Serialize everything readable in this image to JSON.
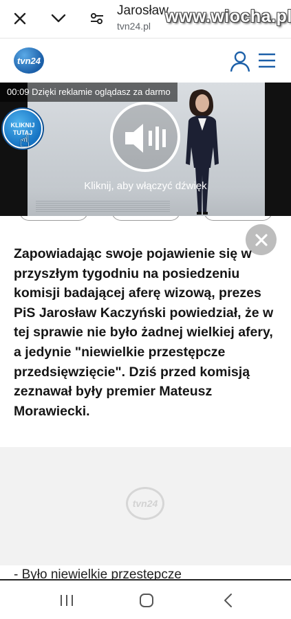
{
  "browser": {
    "title": "Jarosław",
    "url": "tvn24.pl",
    "close_icon": "close-icon",
    "dropdown_icon": "chevron-down-icon",
    "settings_icon": "page-settings-icon"
  },
  "watermark": "www.wiocha.pl",
  "site": {
    "logo_text": "tvn24",
    "user_icon": "user-icon",
    "menu_icon": "hamburger-menu-icon"
  },
  "ad": {
    "counter": "00:09 Dzięki reklamie oglądasz za darmo",
    "click_badge": "KLIKNIJ TUTAJ",
    "sound_prompt": "Kliknij, aby włączyć dźwięk"
  },
  "article": {
    "lead": "Zapowiadając swoje pojawienie się w przyszłym tygodniu na posiedzeniu komisji badającej aferę wizową, prezes PiS Jarosław Kaczyński powiedział, że w tej sprawie nie było żadnej wielkiej afery, a jedynie \"niewielkie przestępcze przedsięwzięcie\". Dziś przed komisją zeznawał były premier Mateusz Morawiecki.",
    "video_logo": "tvn24",
    "next_line": "- Było niewielkie przestępcze"
  }
}
